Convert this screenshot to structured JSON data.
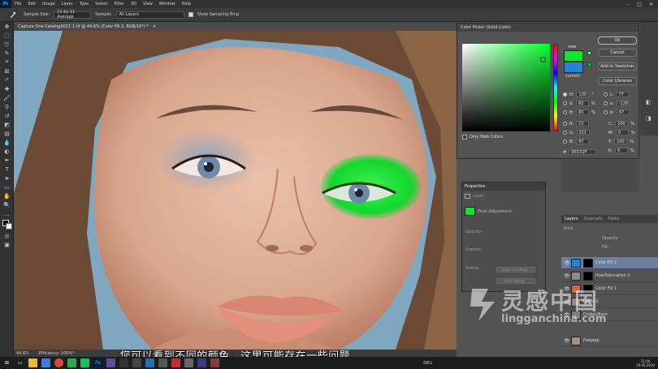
{
  "menubar": {
    "logo": "Ps",
    "items": [
      "File",
      "Edit",
      "Image",
      "Layer",
      "Type",
      "Select",
      "Filter",
      "3D",
      "View",
      "Window",
      "Help"
    ],
    "controls": [
      "–",
      "□",
      "✕"
    ]
  },
  "options_bar": {
    "sample_size_label": "Sample Size:",
    "sample_size_value": "11 by 11 Average",
    "sample_label": "Sample:",
    "sample_value": "All Layers",
    "show_ring_label": "Show Sampling Ring"
  },
  "document": {
    "tab_title": "Capture One Catalog0021 1.tif @ 44.6% (Color Fill 2, RGB/16*) *",
    "zoom": "44.6%",
    "efficiency": "Efficiency: 100%*"
  },
  "subtitle": "您可以看到不同的颜色，这里可能存在一些问题",
  "color_picker": {
    "title": "Color Picker (Solid Color)",
    "new_label": "new",
    "current_label": "current",
    "new_color": "#0ee52f",
    "current_color": "#2584d6",
    "ok_label": "OK",
    "cancel_label": "Cancel",
    "add_swatches_label": "Add to Swatches",
    "libraries_label": "Color Libraries",
    "web_only_label": "Only Web Colors",
    "fields": {
      "H": "130",
      "H_unit": "°",
      "S": "93",
      "S_unit": "%",
      "B": "83",
      "B_unit": "%",
      "R": "15",
      "G": "211",
      "B_rgb": "47",
      "L": "77",
      "a": "-128",
      "b": "67",
      "C": "100",
      "M": "0",
      "Y": "100",
      "K": "0",
      "hex_label": "#",
      "hex": "0ED32F"
    }
  },
  "properties": {
    "tab": "Properties",
    "layer_label": "Layer",
    "preset": "Pixel Adjustment",
    "opacity_label": "Opacity:",
    "feather_label": "Feather:",
    "refine_label": "Refine:",
    "select_mask_btn": "Select and Mask...",
    "color_range_btn": "Color Range..."
  },
  "layers_panel": {
    "tabs": [
      "Layers",
      "Channels",
      "Paths"
    ],
    "kind_label": "Kind",
    "opacity_label": "Opacity:",
    "fill_label": "Fill:",
    "rows": [
      {
        "name": "Color Fill 2",
        "thumb": "#2584d6"
      },
      {
        "name": "Hue/Saturation 1",
        "thumb": "#8a8a8a"
      },
      {
        "name": "Color Fill 1",
        "thumb": "#c96a4f"
      },
      {
        "name": "Layer 1",
        "thumb": "#9a8a7a"
      },
      {
        "name": "Dodge/Burn",
        "thumb": "#808080"
      },
      {
        "name": "Freqsep",
        "thumb": "#a89080"
      }
    ]
  },
  "watermark": {
    "cn": "灵感中国",
    "en": "lingganchina.com"
  },
  "taskbar": {
    "lang": "DEU",
    "time": "11:04",
    "date": "20.05.2019"
  }
}
